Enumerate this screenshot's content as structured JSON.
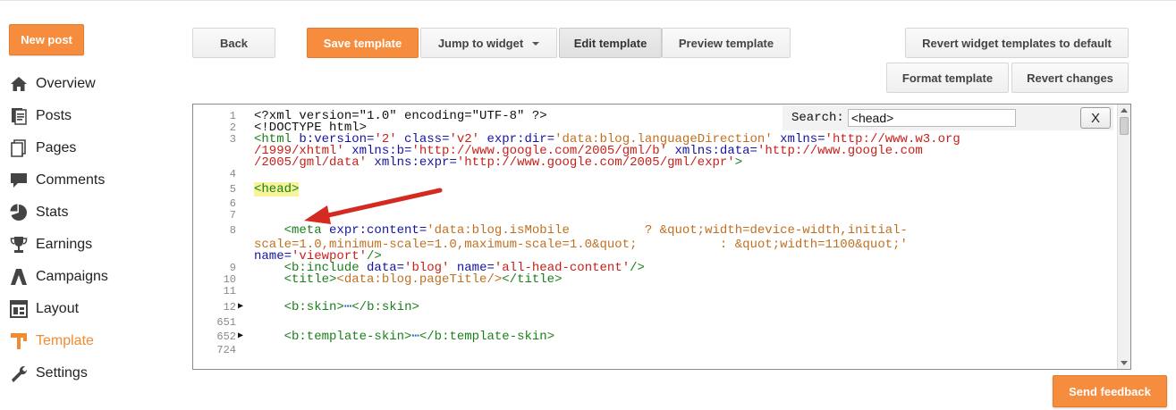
{
  "sidebar": {
    "new_post": "New post",
    "items": [
      {
        "label": "Overview",
        "icon": "home-icon"
      },
      {
        "label": "Posts",
        "icon": "posts-icon"
      },
      {
        "label": "Pages",
        "icon": "pages-icon"
      },
      {
        "label": "Comments",
        "icon": "comments-icon"
      },
      {
        "label": "Stats",
        "icon": "stats-icon"
      },
      {
        "label": "Earnings",
        "icon": "trophy-icon"
      },
      {
        "label": "Campaigns",
        "icon": "campaigns-icon"
      },
      {
        "label": "Layout",
        "icon": "layout-icon"
      },
      {
        "label": "Template",
        "icon": "template-icon",
        "active": true
      },
      {
        "label": "Settings",
        "icon": "wrench-icon"
      }
    ]
  },
  "toolbar": {
    "back": "Back",
    "save_template": "Save template",
    "jump_to_widget": "Jump to widget",
    "edit_template": "Edit template",
    "preview_template": "Preview template",
    "revert_widgets": "Revert widget templates to default",
    "format_template": "Format template",
    "revert_changes": "Revert changes"
  },
  "search": {
    "label": "Search:",
    "value": "<head>",
    "close": "X"
  },
  "code": {
    "line_numbers": [
      "1",
      "2",
      "3",
      "",
      "",
      "4",
      "5",
      "6",
      "7",
      "8",
      "",
      "",
      "9",
      "10",
      "11",
      "12",
      "651",
      "652",
      "724"
    ],
    "l1": "<?xml version=\"1.0\" encoding=\"UTF-8\" ?>",
    "l2": "<!DOCTYPE html>",
    "l3a_tag": "<html ",
    "l3a_a1": "b:version=",
    "l3a_v1": "'2'",
    "l3a_a2": " class=",
    "l3a_v2": "'v2'",
    "l3a_a3": " expr:dir=",
    "l3a_v3": "'data:blog.languageDirection'",
    "l3a_a4": " xmlns=",
    "l3a_v4": "'http://www.w3.org",
    "l3b_v": "/1999/xhtml'",
    "l3b_a1": " xmlns:b=",
    "l3b_v1": "'http://www.google.com/2005/gml/b'",
    "l3b_a2": " xmlns:data=",
    "l3b_v2": "'http://www.google.com",
    "l3c_v": "/2005/gml/data'",
    "l3c_a": " xmlns:expr=",
    "l3c_v2": "'http://www.google.com/2005/gml/expr'",
    "l3c_end": ">",
    "l5": "<head>",
    "l8a_tag": "    <meta ",
    "l8a_a": "expr:content=",
    "l8a_v": "'data:blog.isMobile          ? &quot;width=device-width,initial-",
    "l8b_v": "scale=1.0,minimum-scale=1.0,maximum-scale=1.0&quot;           : &quot;width=1100&quot;'",
    "l8c_a": "name=",
    "l8c_v": "'viewport'",
    "l8c_end": "/>",
    "l9_tag": "    <b:include ",
    "l9_a1": "data=",
    "l9_v1": "'blog'",
    "l9_a2": " name=",
    "l9_v2": "'all-head-content'",
    "l9_end": "/>",
    "l10_open": "    <title>",
    "l10_inner": "<data:blog.pageTitle/>",
    "l10_close": "</title>",
    "l12_open": "    <b:skin>",
    "l12_dots": "⋯",
    "l12_close": "</b:skin>",
    "l652_open": "    <b:template-skin>",
    "l652_dots": "⋯",
    "l652_close": "</b:template-skin>"
  },
  "feedback": "Send feedback",
  "colors": {
    "accent": "#f58c3e",
    "active_text": "#f28a2f",
    "arrow": "#d42a22",
    "highlight": "#f6f39a"
  }
}
